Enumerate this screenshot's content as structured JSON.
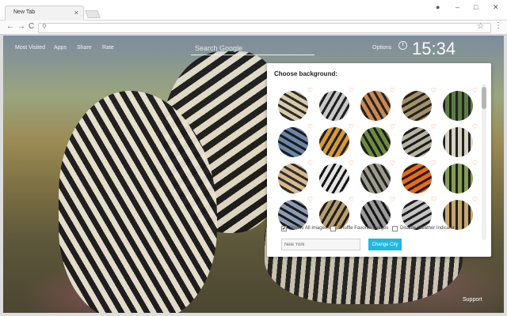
{
  "browser": {
    "tab_title": "New Tab",
    "tab_close": "×",
    "window_controls": [
      "●",
      "–",
      "□",
      "✕"
    ],
    "nav": {
      "back": "←",
      "forward": "→",
      "reload": "C"
    },
    "omnibox_value": "",
    "menu": "⋮",
    "star": "☆"
  },
  "page": {
    "nav": [
      "Most Visited",
      "Apps",
      "Share",
      "Rate"
    ],
    "search_placeholder": "Search Google",
    "options_label": "Options",
    "clock_time": "15:34",
    "support_label": "Support"
  },
  "panel": {
    "title": "Choose background:",
    "heart_symbol": "♡",
    "thumbnails": [
      "zebra-herd",
      "zebra-closeup",
      "zebra-pair-sunset",
      "zebra-group-grass",
      "zebra-green-field",
      "zebra-blue-sky",
      "zebra-savanna-tree",
      "zebra-green-grass",
      "zebra-trio",
      "zebras-river",
      "zebra-face",
      "zebra-stripes-macro",
      "zebra-herd-dust",
      "sunset-savanna",
      "zebra-green-hill",
      "zebra-partial-1",
      "zebra-partial-2",
      "zebra-partial-3",
      "zebra-partial-4",
      "zebra-partial-5"
    ],
    "options": [
      {
        "label": "Shuffle All Images",
        "checked": true
      },
      {
        "label": "Shuffle Favorite Images",
        "checked": false
      },
      {
        "label": "Disable Weather Indicator",
        "checked": false
      }
    ],
    "city_value": "New York",
    "change_city_label": "Change City"
  },
  "colors": {
    "accent": "#1fb8e0",
    "heart": "#f0894e"
  }
}
